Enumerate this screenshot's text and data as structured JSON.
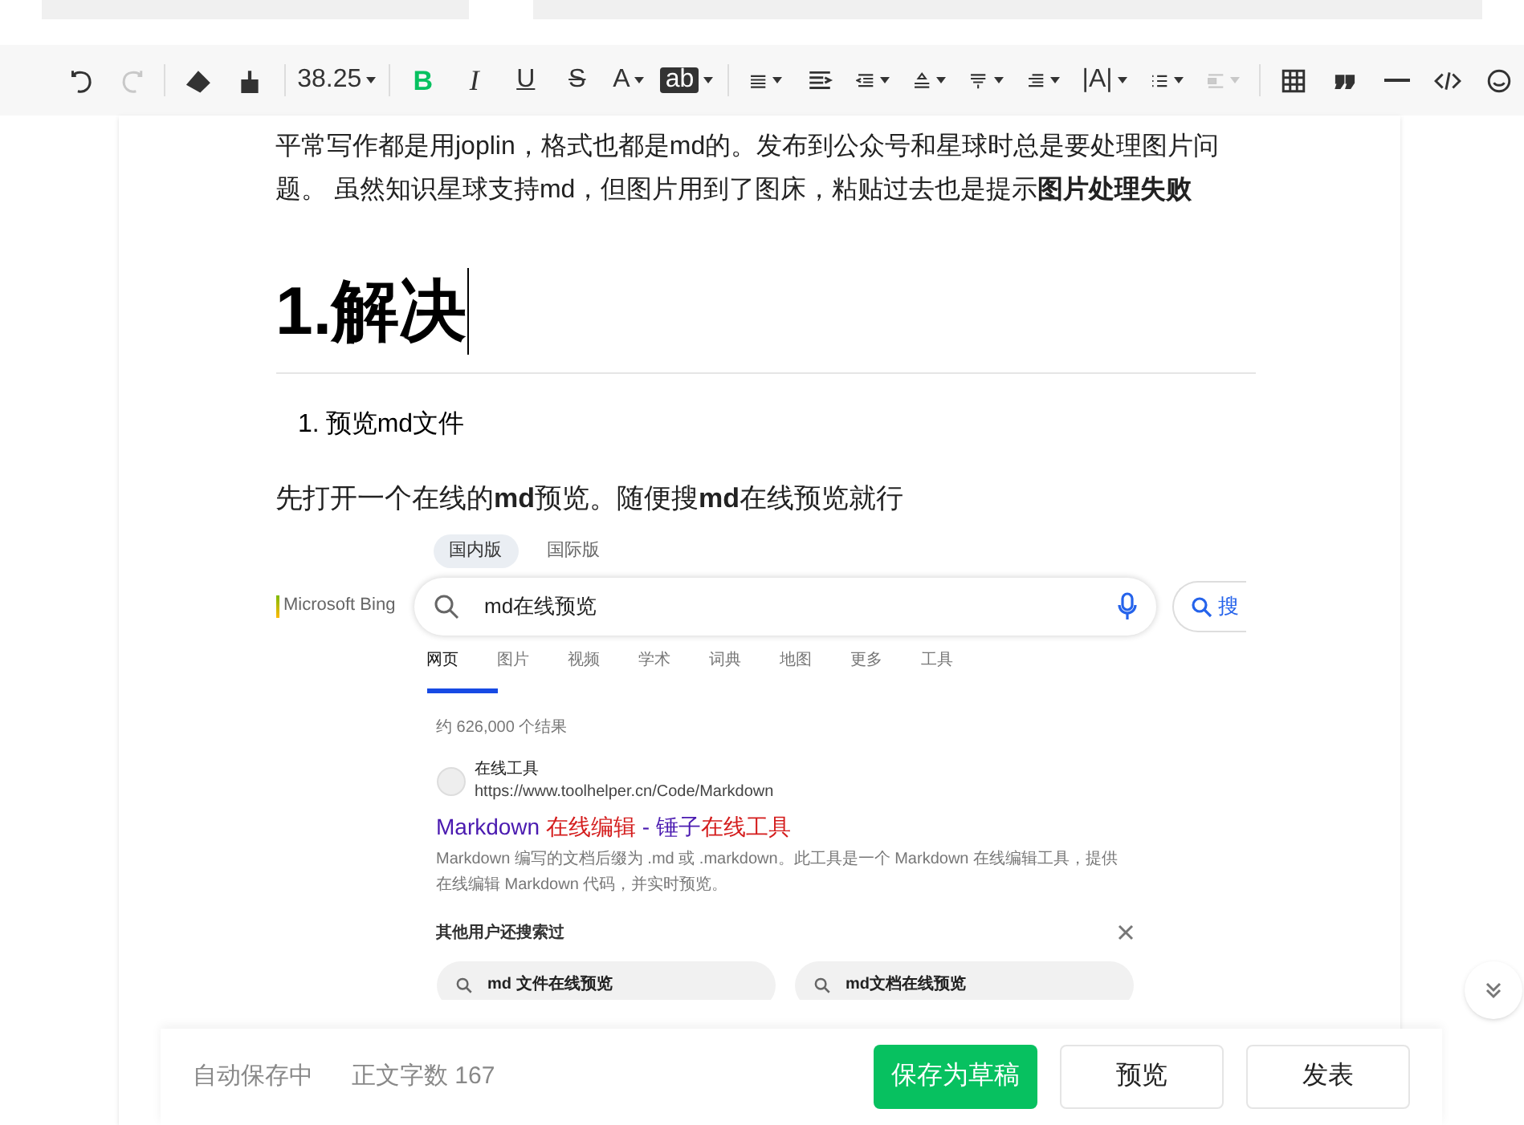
{
  "toolbar": [
    {
      "kind": "icon"
    },
    {
      "kind": "icon",
      "disabled": true
    },
    {
      "kind": "icon"
    },
    {
      "kind": "icon"
    },
    {
      "kind": "text",
      "label": "38.25"
    },
    {
      "kind": "text",
      "label": "B",
      "active": true
    },
    {
      "kind": "text",
      "label": "I"
    },
    {
      "kind": "text",
      "label": "U"
    },
    {
      "kind": "text",
      "label": "S"
    },
    {
      "kind": "text",
      "label": "A"
    },
    {
      "kind": "text",
      "label": "ab"
    },
    {
      "kind": "icon"
    },
    {
      "kind": "icon"
    },
    {
      "kind": "icon"
    },
    {
      "kind": "icon"
    },
    {
      "kind": "icon"
    },
    {
      "kind": "icon"
    },
    {
      "kind": "text",
      "label": "|A|"
    },
    {
      "kind": "icon"
    },
    {
      "kind": "icon",
      "disabled": true
    },
    {
      "kind": "icon"
    },
    {
      "kind": "icon"
    },
    {
      "kind": "icon"
    },
    {
      "kind": "icon"
    },
    {
      "kind": "icon"
    }
  ],
  "document": {
    "paragraph": "平常写作都是用joplin，格式也都是md的。发布到公众号和星球时总是要处理图片问题。 虽然知识星球支持md，但图片用到了图床，粘贴过去也是提示**图片处理失败**",
    "heading": "1.解决",
    "list_item": {
      "number": "1.",
      "text": "预览md文件"
    },
    "paragraph2": "先打开一个在线的**md**预览。随便搜**md**在线预览就行"
  },
  "embedded_screenshot": {
    "version_tabs": [
      {
        "label": "国内版",
        "selected": true
      },
      {
        "label": "国际版",
        "selected": false
      }
    ],
    "logo": "Microsoft Bing",
    "query": "md在线预览",
    "search_button": "搜",
    "tabs": [
      {
        "label": "网页",
        "selected": true
      },
      {
        "label": "图片",
        "selected": false
      },
      {
        "label": "视频",
        "selected": false
      },
      {
        "label": "学术",
        "selected": false
      },
      {
        "label": "词典",
        "selected": false
      },
      {
        "label": "地图",
        "selected": false
      },
      {
        "label": "更多",
        "selected": false
      },
      {
        "label": "工具",
        "selected": false
      }
    ],
    "result_count": "约 626,000 个结果",
    "result": {
      "site": "在线工具",
      "url": "https://www.toolhelper.cn/Code/Markdown",
      "title_parts": [
        {
          "text": "Markdown ",
          "highlight": false
        },
        {
          "text": "在线编辑",
          "highlight": true
        },
        {
          "text": " - 锤子",
          "highlight": false
        },
        {
          "text": "在线工具",
          "highlight": true
        }
      ],
      "snippet": "Markdown 编写的文档后缀为 .md 或 .markdown。此工具是一个 Markdown 在线编辑工具，提供在线编辑 Markdown 代码，并实时预览。"
    },
    "related_title": "其他用户还搜索过",
    "related": [
      "md 文件在线预览",
      "md文档在线预览"
    ]
  },
  "footer": {
    "autosave": "自动保存中",
    "word_count": "正文字数 167",
    "buttons": [
      {
        "label": "保存为草稿",
        "primary": true
      },
      {
        "label": "预览",
        "primary": false
      },
      {
        "label": "发表",
        "primary": false
      }
    ]
  }
}
